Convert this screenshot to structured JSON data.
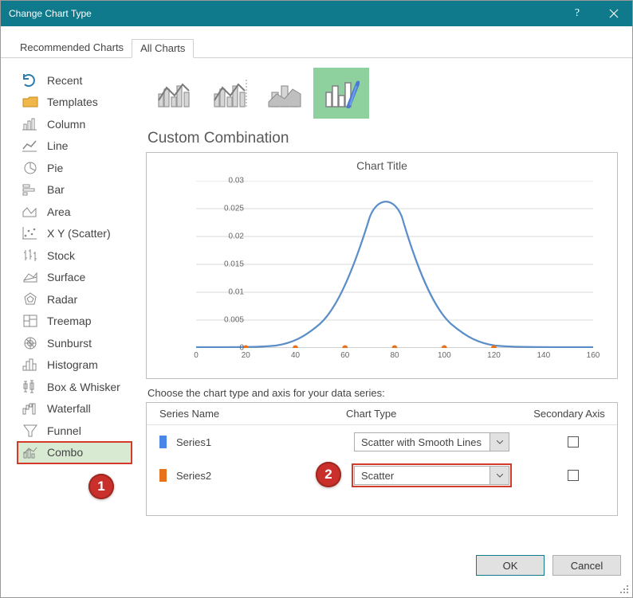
{
  "window": {
    "title": "Change Chart Type"
  },
  "tabs": {
    "recommended": "Recommended Charts",
    "all": "All Charts"
  },
  "sidebar": {
    "items": [
      {
        "label": "Recent"
      },
      {
        "label": "Templates"
      },
      {
        "label": "Column"
      },
      {
        "label": "Line"
      },
      {
        "label": "Pie"
      },
      {
        "label": "Bar"
      },
      {
        "label": "Area"
      },
      {
        "label": "X Y (Scatter)"
      },
      {
        "label": "Stock"
      },
      {
        "label": "Surface"
      },
      {
        "label": "Radar"
      },
      {
        "label": "Treemap"
      },
      {
        "label": "Sunburst"
      },
      {
        "label": "Histogram"
      },
      {
        "label": "Box & Whisker"
      },
      {
        "label": "Waterfall"
      },
      {
        "label": "Funnel"
      },
      {
        "label": "Combo"
      }
    ]
  },
  "main": {
    "section_title": "Custom Combination",
    "instruction": "Choose the chart type and axis for your data series:",
    "headers": {
      "name": "Series Name",
      "type": "Chart Type",
      "axis": "Secondary Axis"
    },
    "series": [
      {
        "name": "Series1",
        "color": "#4a86e8",
        "type": "Scatter with Smooth Lines",
        "secondary": false
      },
      {
        "name": "Series2",
        "color": "#e8711c",
        "type": "Scatter",
        "secondary": false
      }
    ]
  },
  "chart_data": {
    "type": "combo",
    "title": "Chart Title",
    "xlim": [
      0,
      160
    ],
    "ylim": [
      0,
      0.03
    ],
    "xticks": [
      0,
      20,
      40,
      60,
      80,
      100,
      120,
      140,
      160
    ],
    "yticks": [
      0,
      0.005,
      0.01,
      0.015,
      0.02,
      0.025,
      0.03
    ],
    "series": [
      {
        "name": "Series1",
        "type": "line",
        "color": "#5b8ec9",
        "x": [
          0,
          10,
          20,
          30,
          40,
          50,
          55,
          60,
          65,
          70,
          75,
          80,
          85,
          90,
          95,
          100,
          110,
          120,
          130,
          140,
          150,
          160
        ],
        "y": [
          0.0001,
          0.0001,
          0.0002,
          0.0006,
          0.0018,
          0.0048,
          0.008,
          0.0128,
          0.018,
          0.0225,
          0.0248,
          0.0248,
          0.0225,
          0.018,
          0.0128,
          0.008,
          0.0025,
          0.0006,
          0.0002,
          0.0001,
          0.0001,
          0.0001
        ]
      },
      {
        "name": "Series2",
        "type": "scatter",
        "color": "#e8711c",
        "x": [
          20,
          40,
          60,
          80,
          100,
          120
        ],
        "y": [
          0,
          0,
          0,
          0,
          0,
          0
        ]
      }
    ]
  },
  "callouts": {
    "one": "1",
    "two": "2"
  },
  "footer": {
    "ok": "OK",
    "cancel": "Cancel"
  }
}
